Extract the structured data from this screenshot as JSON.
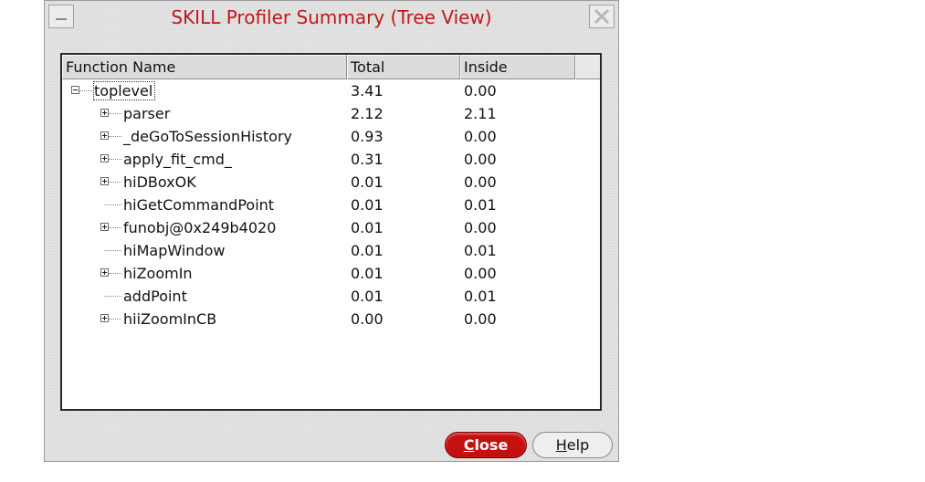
{
  "window": {
    "title": "SKILL Profiler Summary (Tree View)"
  },
  "tree": {
    "columns": {
      "name": "Function Name",
      "total": "Total",
      "inside": "Inside"
    },
    "rows": [
      {
        "name": "toplevel",
        "total": "3.41",
        "inside": "0.00",
        "expander": "minus"
      },
      {
        "name": "parser",
        "total": "2.12",
        "inside": "2.11",
        "expander": "plus"
      },
      {
        "name": "_deGoToSessionHistory",
        "total": "0.93",
        "inside": "0.00",
        "expander": "plus"
      },
      {
        "name": "apply_fit_cmd_",
        "total": "0.31",
        "inside": "0.00",
        "expander": "plus"
      },
      {
        "name": "hiDBoxOK",
        "total": "0.01",
        "inside": "0.00",
        "expander": "plus"
      },
      {
        "name": "hiGetCommandPoint",
        "total": "0.01",
        "inside": "0.01",
        "expander": "none"
      },
      {
        "name": "funobj@0x249b4020",
        "total": "0.01",
        "inside": "0.00",
        "expander": "plus"
      },
      {
        "name": "hiMapWindow",
        "total": "0.01",
        "inside": "0.01",
        "expander": "none"
      },
      {
        "name": "hiZoomIn",
        "total": "0.01",
        "inside": "0.00",
        "expander": "plus"
      },
      {
        "name": "addPoint",
        "total": "0.01",
        "inside": "0.01",
        "expander": "none"
      },
      {
        "name": "hiiZoomInCB",
        "total": "0.00",
        "inside": "0.00",
        "expander": "plus"
      }
    ]
  },
  "buttons": {
    "close_label_first": "C",
    "close_label_rest": "lose",
    "help_label_first": "H",
    "help_label_rest": "elp"
  },
  "colors": {
    "title": "#c01818",
    "close_button": "#c51010"
  },
  "icons": {
    "minimize": "minimize-icon",
    "close": "close-x-icon",
    "expand": "plus-box-icon",
    "collapse": "minus-box-icon"
  }
}
